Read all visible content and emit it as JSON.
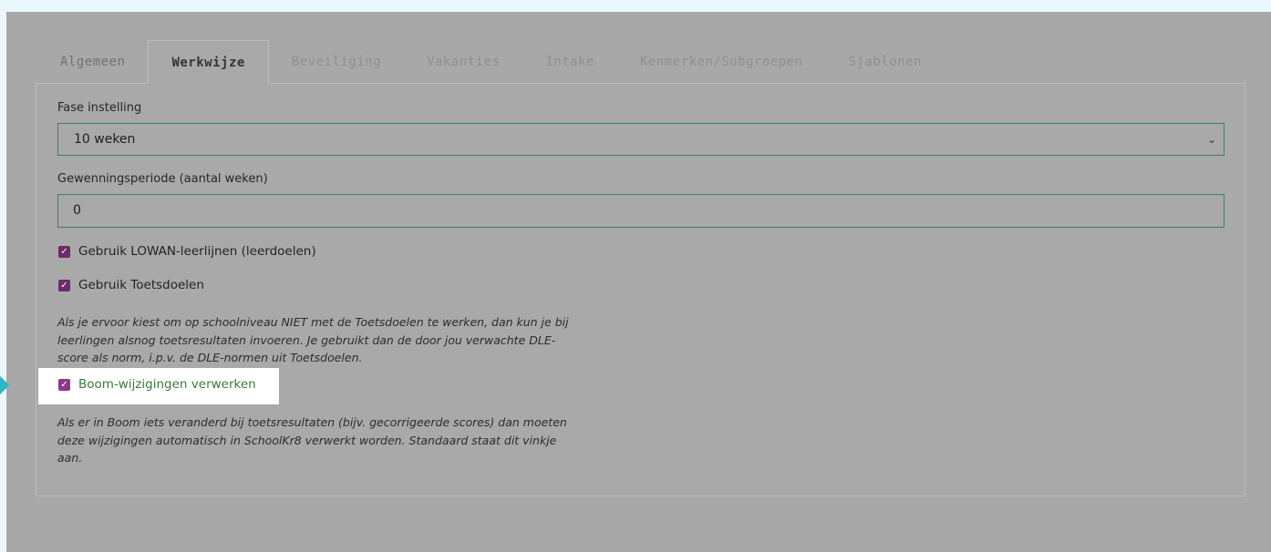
{
  "tabs": [
    {
      "label": "Algemeen",
      "active": false
    },
    {
      "label": "Werkwijze",
      "active": true
    },
    {
      "label": "Beveiliging",
      "active": false
    },
    {
      "label": "Vakanties",
      "active": false
    },
    {
      "label": "Intake",
      "active": false
    },
    {
      "label": "Kenmerken/Subgroepen",
      "active": false
    },
    {
      "label": "Sjablonen",
      "active": false
    }
  ],
  "form": {
    "fase_label": "Fase instelling",
    "fase_value": "10 weken",
    "gewenning_label": "Gewenningsperiode (aantal weken)",
    "gewenning_value": "0",
    "lowan_label": "Gebruik LOWAN-leerlijnen (leerdoelen)",
    "lowan_checked": true,
    "toetsdoelen_label": "Gebruik Toetsdoelen",
    "toetsdoelen_checked": true,
    "toetsdoelen_help_1": "Als je ervoor kiest om op schoolniveau NIET met de Toetsdoelen te werken, dan kun je bij",
    "toetsdoelen_help_2": "leerlingen alsnog toetsresultaten invoeren. Je gebruikt dan de door jou verwachte DLE-",
    "toetsdoelen_help_3": "score als norm, i.p.v. de DLE-normen uit Toetsdoelen.",
    "boom_label": "Boom-wijzigingen verwerken",
    "boom_checked": true,
    "boom_help_1": "Als er in Boom iets veranderd bij toetsresultaten (bijv. gecorrigeerde scores) dan moeten",
    "boom_help_2": "deze wijzigingen automatisch in SchoolKr8 verwerkt worden. Standaard staat dit vinkje",
    "boom_help_3": "aan."
  },
  "colors": {
    "accent_border": "#3f8060",
    "checkbox": "#6d2a6c",
    "arrow": "#2fb8c4",
    "highlight_text": "#3a7a3a"
  },
  "icons": {
    "select_caret": "chevron-down-icon",
    "checkbox": "check-icon",
    "pointer": "arrow-right-icon"
  }
}
